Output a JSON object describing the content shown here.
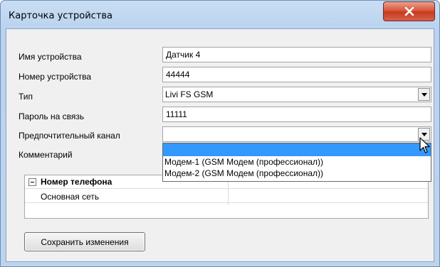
{
  "window": {
    "title": "Карточка устройства",
    "close_icon": "close-x-icon"
  },
  "form": {
    "fields": [
      {
        "label": "Имя устройства",
        "value": "Датчик 4"
      },
      {
        "label": "Номер устройства",
        "value": "44444"
      },
      {
        "label": "Тип",
        "value": "Livi FS GSM"
      },
      {
        "label": "Пароль на связь",
        "value": "11111"
      },
      {
        "label": "Предпочтительный канал",
        "value": ""
      },
      {
        "label": "Комментарий",
        "value": ""
      }
    ]
  },
  "dropdown": {
    "options": [
      "",
      "Модем-1 (GSM Модем (профессионал))",
      "Модем-2 (GSM Модем (профессионал))"
    ],
    "selected_index": 0,
    "selected_color": "#3399ff"
  },
  "grid": {
    "group_title": "Номер телефона",
    "rows": [
      {
        "label": "Основная сеть",
        "value": ""
      }
    ]
  },
  "actions": {
    "save_label": "Сохранить изменения"
  }
}
